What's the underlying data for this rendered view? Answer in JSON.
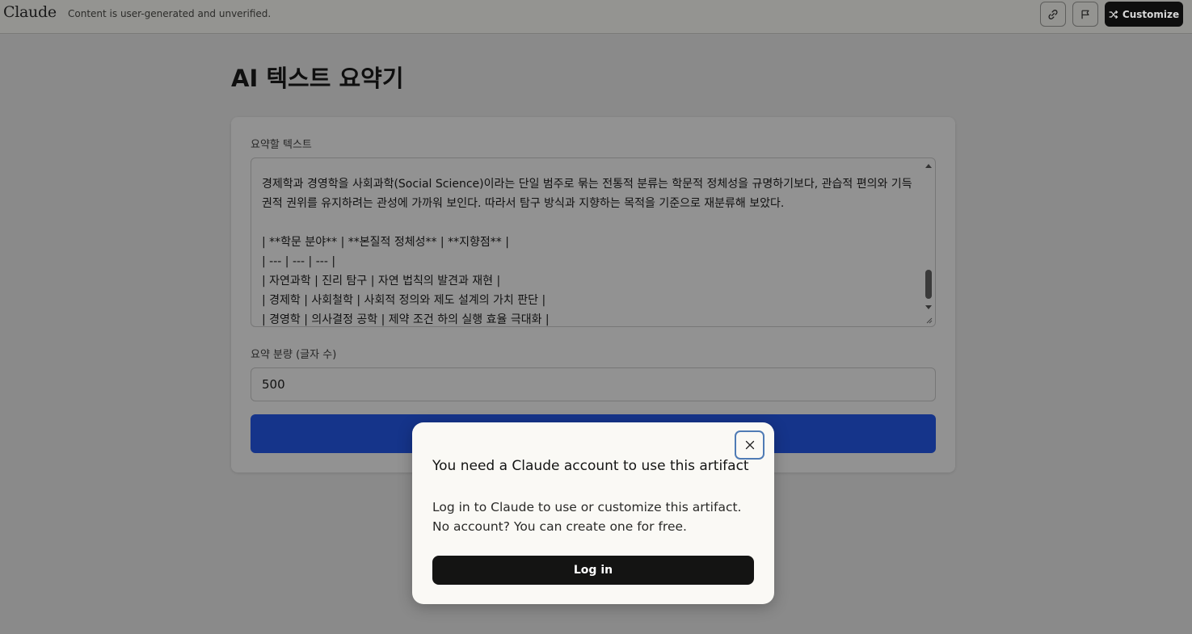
{
  "topbar": {
    "brand": "Claude",
    "notice": "Content is user-generated and unverified.",
    "link_icon": "link-icon",
    "flag_icon": "flag-icon",
    "customize_label": "Customize",
    "customize_icon": "shuffle-icon"
  },
  "artifact": {
    "title": "AI 텍스트 요약기",
    "text_label": "요약할 텍스트",
    "text_value": "경제학과 경영학을 사회과학(Social Science)이라는 단일 범주로 묶는 전통적 분류는 학문적 정체성을 규명하기보다, 관습적 편의와 기득권적 권위를 유지하려는 관성에 가까워 보인다. 따라서 탐구 방식과 지향하는 목적을 기준으로 재분류해 보았다.\n\n| **학문 분야** | **본질적 정체성** | **지향점** |\n| --- | --- | --- |\n| 자연과학 | 진리 탐구 | 자연 법칙의 발견과 재현 |\n| 경제학 | 사회철학 | 사회적 정의와 제도 설계의 가치 판단 |\n| 경영학 | 의사결정 공학 | 제약 조건 하의 실행 효율 극대화 |",
    "length_label": "요약 분량 (글자 수)",
    "length_value": "500"
  },
  "modal": {
    "title": "You need a Claude account to use this artifact",
    "body": "Log in to Claude to use or customize this artifact. No account? You can create one for free.",
    "login_label": "Log in",
    "close_icon": "close-icon"
  },
  "colors": {
    "submit_button": "#15348a",
    "modal_bg": "#faf9f5",
    "login_button": "#141413",
    "focus_ring": "#4f7bb5"
  }
}
